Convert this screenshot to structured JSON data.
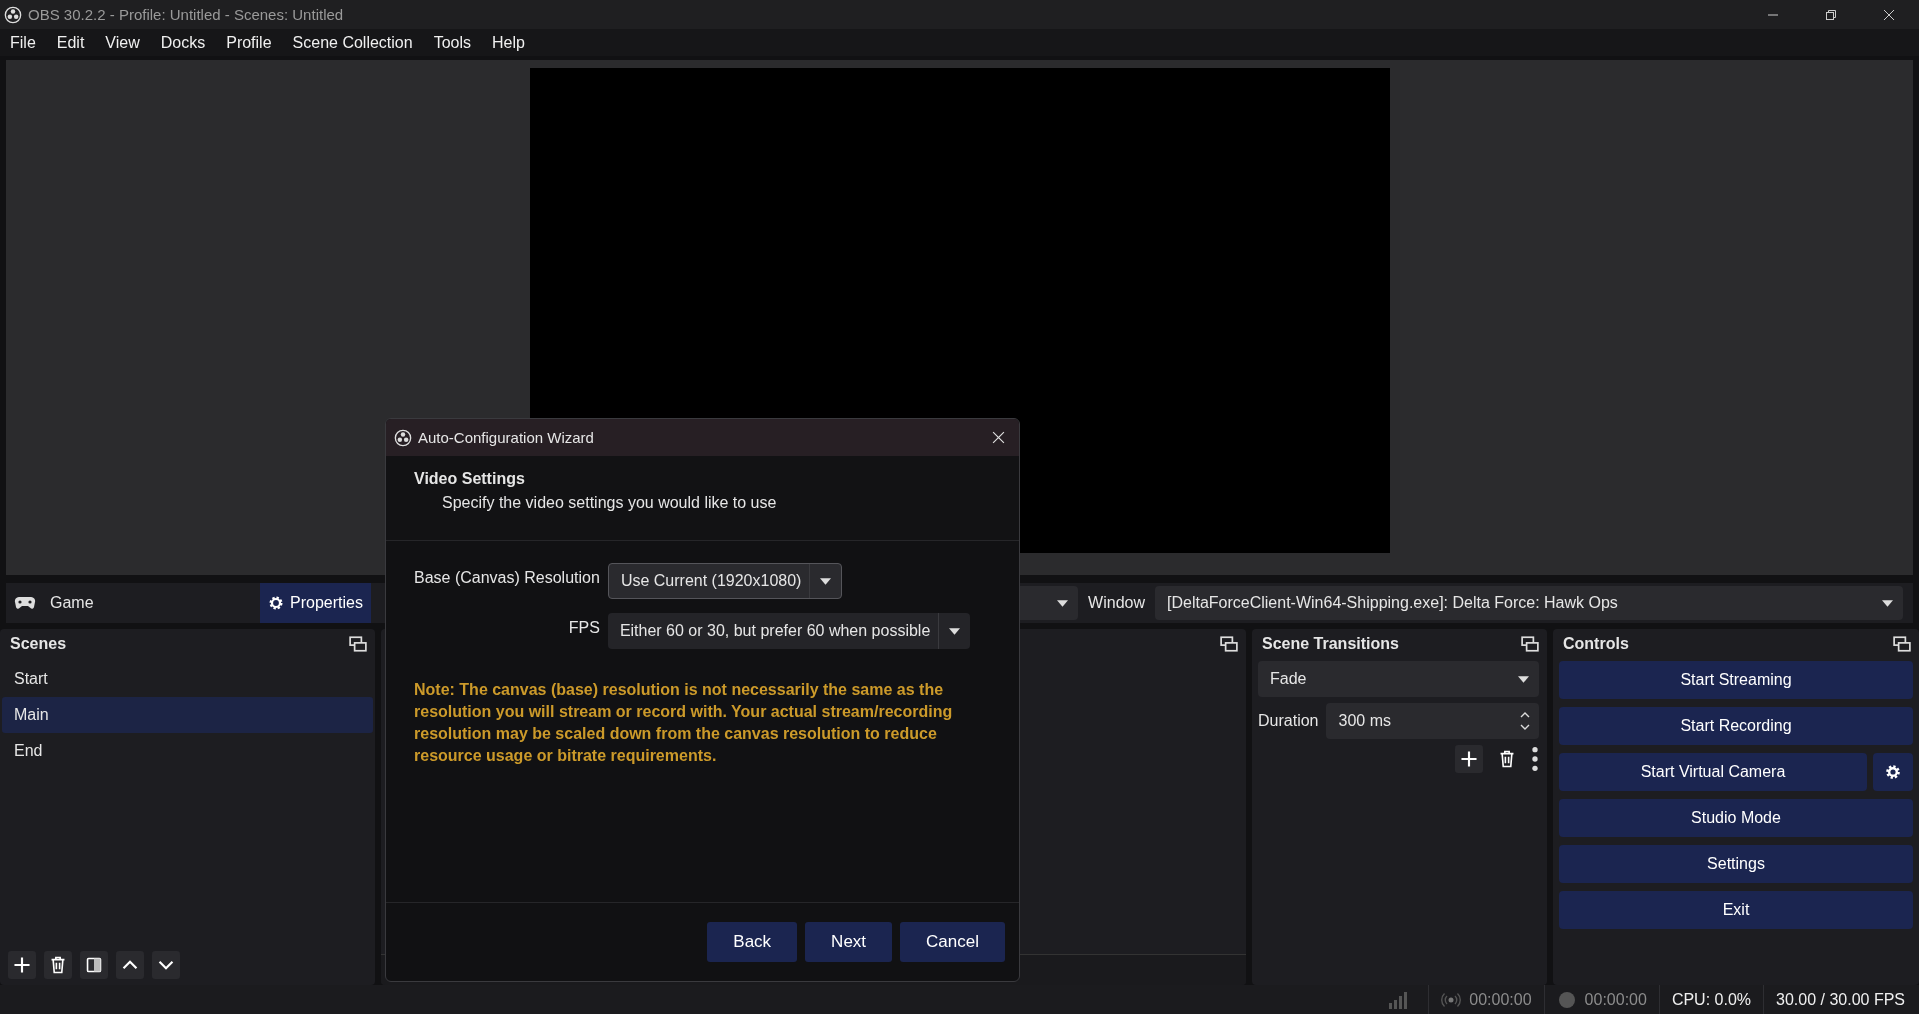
{
  "window": {
    "title": "OBS 30.2.2 - Profile: Untitled - Scenes: Untitled"
  },
  "menu": [
    "File",
    "Edit",
    "View",
    "Docks",
    "Profile",
    "Scene Collection",
    "Tools",
    "Help"
  ],
  "source_toolbar": {
    "source_name": "Game",
    "properties_button": "Properties",
    "window_label": "Window",
    "window_value": "[DeltaForceClient-Win64-Shipping.exe]: Delta Force: Hawk Ops"
  },
  "scenes": {
    "title": "Scenes",
    "items": [
      {
        "label": "Start",
        "selected": false
      },
      {
        "label": "Main",
        "selected": true
      },
      {
        "label": "End",
        "selected": false
      }
    ]
  },
  "transitions": {
    "title": "Scene Transitions",
    "transition": "Fade",
    "duration_label": "Duration",
    "duration_value": "300 ms"
  },
  "controls": {
    "title": "Controls",
    "buttons": [
      {
        "label": "Start Streaming",
        "kind": "plain"
      },
      {
        "label": "Start Recording",
        "kind": "plain"
      },
      {
        "label": "Start Virtual Camera",
        "kind": "with_settings"
      },
      {
        "label": "Studio Mode",
        "kind": "plain"
      },
      {
        "label": "Settings",
        "kind": "plain"
      },
      {
        "label": "Exit",
        "kind": "plain"
      }
    ]
  },
  "status_bar": {
    "stream_time": "00:00:00",
    "record_time": "00:00:00",
    "cpu": "CPU: 0.0%",
    "fps": "30.00 / 30.00 FPS"
  },
  "dialog": {
    "title": "Auto-Configuration Wizard",
    "heading": "Video Settings",
    "subheading": "Specify the video settings you would like to use",
    "fields": [
      {
        "label": "Base (Canvas) Resolution",
        "value": "Use Current (1920x1080)"
      },
      {
        "label": "FPS",
        "value": "Either 60 or 30, but prefer 60 when possible"
      }
    ],
    "note": "Note: The canvas (base) resolution is not necessarily the same as the resolution you will stream or record with. Your actual stream/recording resolution may be scaled down from the canvas resolution to reduce resource usage or bitrate requirements.",
    "buttons": [
      "Back",
      "Next",
      "Cancel"
    ]
  }
}
